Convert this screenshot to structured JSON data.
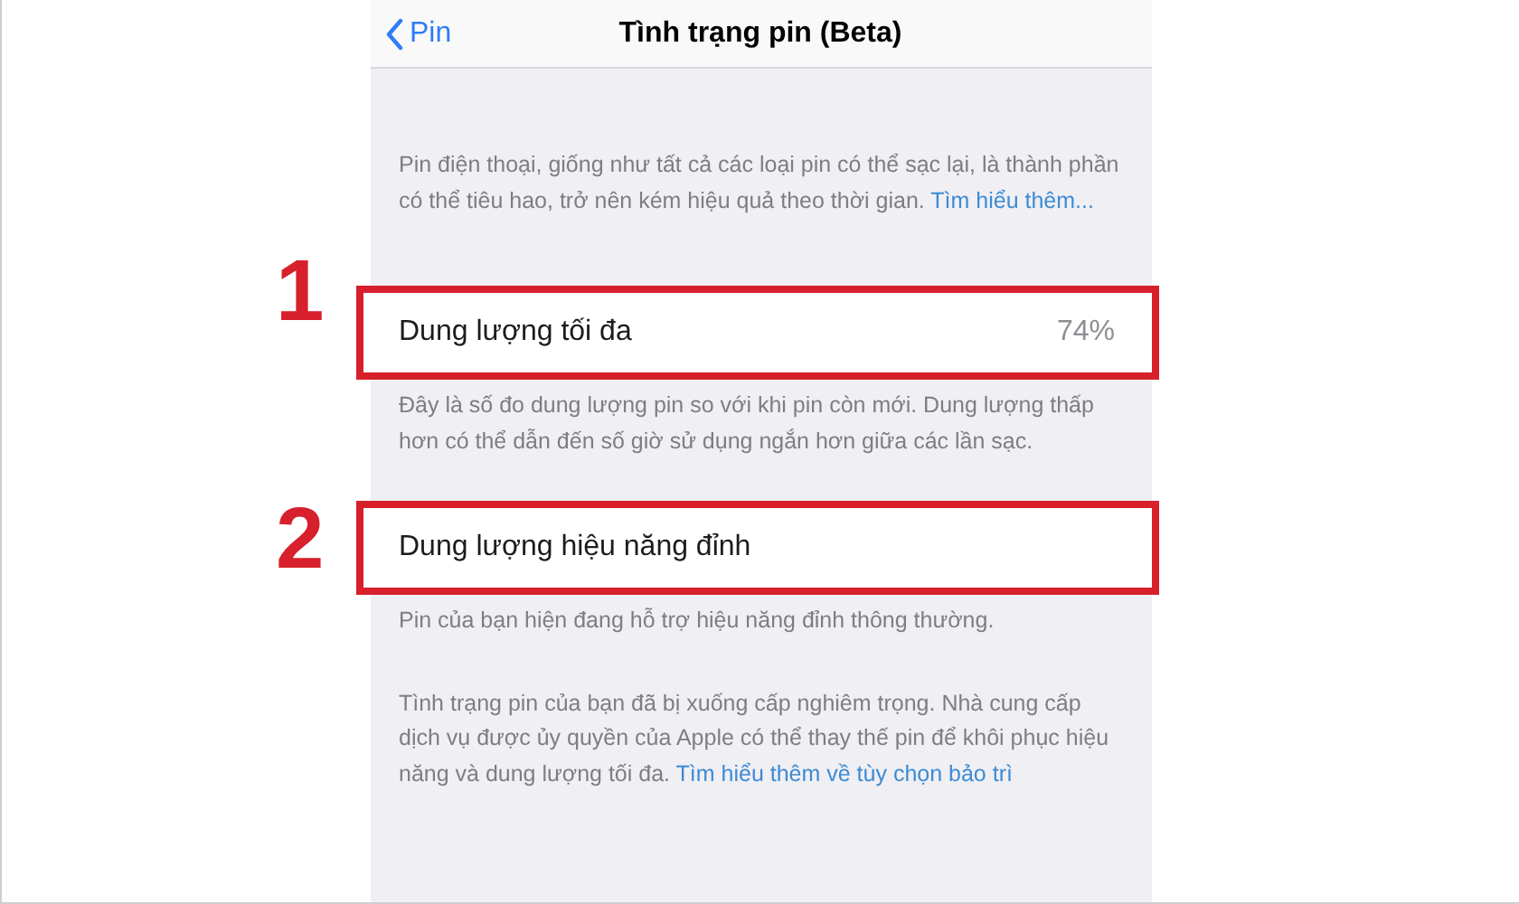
{
  "nav_bar": {
    "back_label": "Pin",
    "title": "Tình trạng pin (Beta)"
  },
  "intro": {
    "text": "Pin điện thoại, giống như tất cả các loại pin có thể sạc lại, là thành phần có thể tiêu hao, trở nên kém hiệu quả theo thời gian.",
    "link": "Tìm hiểu thêm..."
  },
  "rows": [
    {
      "label": "Dung lượng tối đa",
      "value": "74%",
      "annotation": "1",
      "footer": "Đây là số đo dung lượng pin so với khi pin còn mới. Dung lượng thấp hơn có thể dẫn đến số giờ sử dụng ngắn hơn giữa các lần sạc."
    },
    {
      "label": "Dung lượng hiệu năng đỉnh",
      "annotation": "2",
      "footer": "Pin của bạn hiện đang hỗ trợ hiệu năng đỉnh thông thường."
    }
  ],
  "warning": {
    "text": "Tình trạng pin của bạn đã bị xuống cấp nghiêm trọng. Nhà cung cấp dịch vụ được ủy quyền của Apple có thể thay thế pin để khôi phục hiệu năng và dung lượng tối đa.",
    "link": "Tìm hiểu thêm về tùy chọn bảo trì"
  }
}
